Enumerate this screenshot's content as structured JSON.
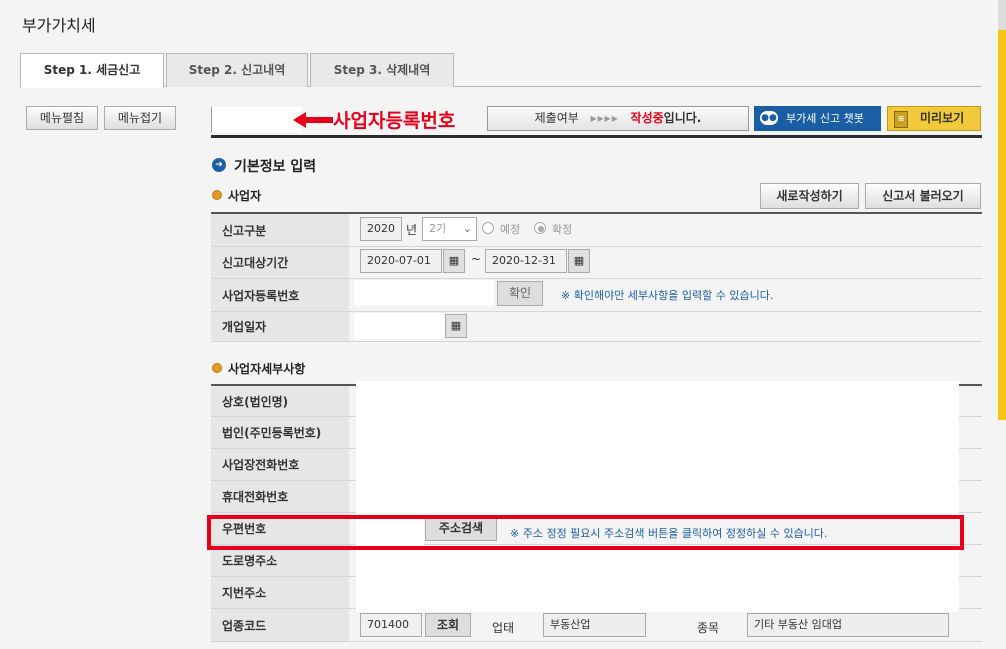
{
  "page": {
    "title": "부가가치세"
  },
  "tabs": [
    {
      "label": "Step 1. 세금신고"
    },
    {
      "label": "Step 2. 신고내역"
    },
    {
      "label": "Step 3. 삭제내역"
    }
  ],
  "sidebar": {
    "expand_label": "메뉴펼침",
    "collapse_label": "메뉴접기"
  },
  "annotation": {
    "reg_label": "사업자등록번호"
  },
  "status": {
    "label": "제출여부",
    "arrows": "▸▸▸▸",
    "value": "작성중",
    "suffix": "입니다."
  },
  "buttons": {
    "chatbot": "부가세 신고 챗봇",
    "preview": "미리보기",
    "new_write": "새로작성하기",
    "load_report": "신고서 불러오기",
    "confirm": "확인",
    "address_search": "주소검색",
    "lookup": "조회"
  },
  "sections": {
    "basic_info": "기본정보 입력",
    "business": "사업자",
    "business_detail": "사업자세부사항"
  },
  "form": {
    "report_type": {
      "label": "신고구분",
      "year": "2020",
      "year_unit": "년",
      "period": "2기",
      "option1": "예정",
      "option2": "확정",
      "selected": "확정"
    },
    "period": {
      "label": "신고대상기간",
      "start": "2020-07-01",
      "sep": "~",
      "end": "2020-12-31"
    },
    "reg_number": {
      "label": "사업자등록번호",
      "value": "",
      "note": "※ 확인해야만 세부사항을 입력할 수 있습니다."
    },
    "open_date": {
      "label": "개업일자",
      "value": ""
    }
  },
  "detail": {
    "labels": [
      "상호(법인명)",
      "법인(주민등록번호)",
      "사업장전화번호",
      "휴대전화번호",
      "우편번호",
      "도로명주소",
      "지번주소",
      "업종코드"
    ],
    "postal_note": "※ 주소 정정 필요시 주소검색 버튼을 클릭하여 정정하실 수 있습니다.",
    "industry_code": "701400",
    "business_type_label": "업태",
    "business_type": "부동산업",
    "item_label": "종목",
    "item": "기타 부동산 임대업"
  },
  "colors": {
    "accent": "#1a5fa6",
    "annotation": "#e6001a",
    "preview": "#f1c93a",
    "strip": "#f5c518"
  }
}
